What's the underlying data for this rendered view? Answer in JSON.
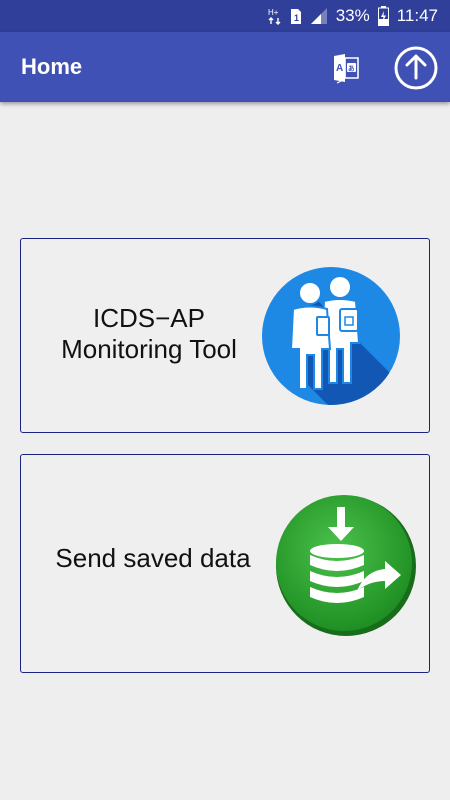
{
  "status_bar": {
    "icons": [
      "data-transfer-icon",
      "sim-icon",
      "signal-icon",
      "battery-charging-icon"
    ],
    "battery_percent": "33%",
    "time": "11:47"
  },
  "app_bar": {
    "title": "Home",
    "actions": [
      "translate-icon",
      "upload-icon"
    ]
  },
  "cards": [
    {
      "line1": "ICDS−AP",
      "line2": "Monitoring Tool",
      "icon": "people-with-tablet-icon"
    },
    {
      "label": "Send saved data",
      "icon": "database-send-icon"
    }
  ],
  "colors": {
    "status_bar": "#2f3f9a",
    "app_bar": "#3f51b5",
    "card_border": "#1a237e",
    "background": "#eeeeee",
    "icon_blue": "#1e88e5",
    "icon_green": "#2e9e2e"
  }
}
